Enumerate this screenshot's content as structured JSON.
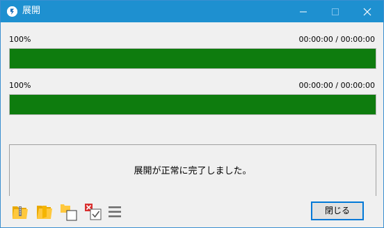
{
  "window": {
    "title": "展開",
    "controls": [
      "minimize",
      "maximize",
      "close"
    ]
  },
  "progress": [
    {
      "percent_label": "100%",
      "time_label": "00:00:00 / 00:00:00",
      "value": 1.0
    },
    {
      "percent_label": "100%",
      "time_label": "00:00:00 / 00:00:00",
      "value": 1.0
    }
  ],
  "message": "展開が正常に完了しました。",
  "toolbar": {
    "icons": [
      "open-archive-icon",
      "open-folder-icon",
      "copy-icon",
      "delete-check-icon",
      "menu-icon"
    ]
  },
  "buttons": {
    "close_label": "閉じる"
  },
  "colors": {
    "titlebar": "#1e90d0",
    "progress_fill": "#0e7c0e",
    "accent_border": "#0078d7"
  }
}
